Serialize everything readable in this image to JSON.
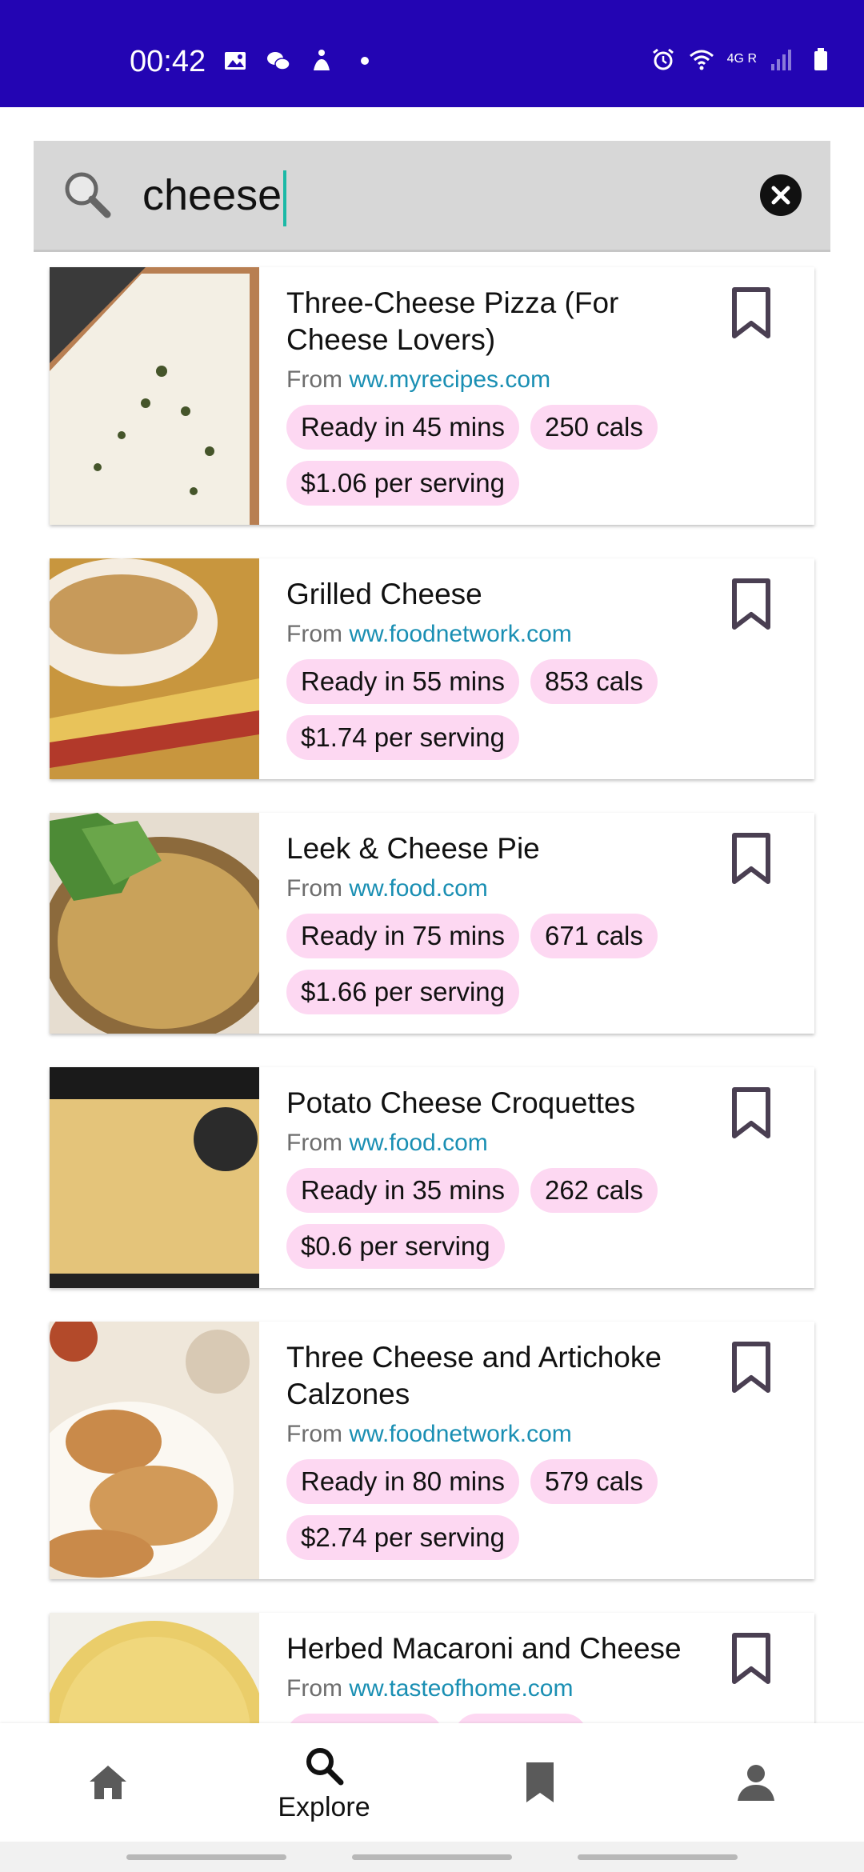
{
  "status_bar": {
    "time": "00:42",
    "network": "4G R"
  },
  "search": {
    "value": "cheese"
  },
  "results": [
    {
      "title": "Three-Cheese Pizza (For Cheese Lovers)",
      "source_prefix": "From",
      "source": "ww.myrecipes.com",
      "ready": "Ready in 45 mins",
      "cals": "250 cals",
      "price": "$1.06 per serving"
    },
    {
      "title": "Grilled Cheese",
      "source_prefix": "From",
      "source": "ww.foodnetwork.com",
      "ready": "Ready in 55 mins",
      "cals": "853 cals",
      "price": "$1.74 per serving"
    },
    {
      "title": "Leek & Cheese Pie",
      "source_prefix": "From",
      "source": "ww.food.com",
      "ready": "Ready in 75 mins",
      "cals": "671 cals",
      "price": "$1.66 per serving"
    },
    {
      "title": "Potato Cheese Croquettes",
      "source_prefix": "From",
      "source": "ww.food.com",
      "ready": "Ready in 35 mins",
      "cals": "262 cals",
      "price": "$0.6 per serving"
    },
    {
      "title": "Three Cheese and Artichoke Calzones",
      "source_prefix": "From",
      "source": "ww.foodnetwork.com",
      "ready": "Ready in 80 mins",
      "cals": "579 cals",
      "price": "$2.74 per serving"
    },
    {
      "title": "Herbed Macaroni and Cheese",
      "source_prefix": "From",
      "source": "ww.tasteofhome.com",
      "ready": "",
      "cals": "",
      "price": ""
    }
  ],
  "bottom_nav": {
    "items": [
      {
        "icon": "home-icon",
        "label": ""
      },
      {
        "icon": "search-icon",
        "label": "Explore"
      },
      {
        "icon": "bookmark-icon",
        "label": ""
      },
      {
        "icon": "person-icon",
        "label": ""
      }
    ]
  },
  "colors": {
    "status_bar": "#2305b3",
    "chip": "#fdd8f2",
    "link": "#1a8fb3",
    "cursor": "#1bb9a6"
  }
}
